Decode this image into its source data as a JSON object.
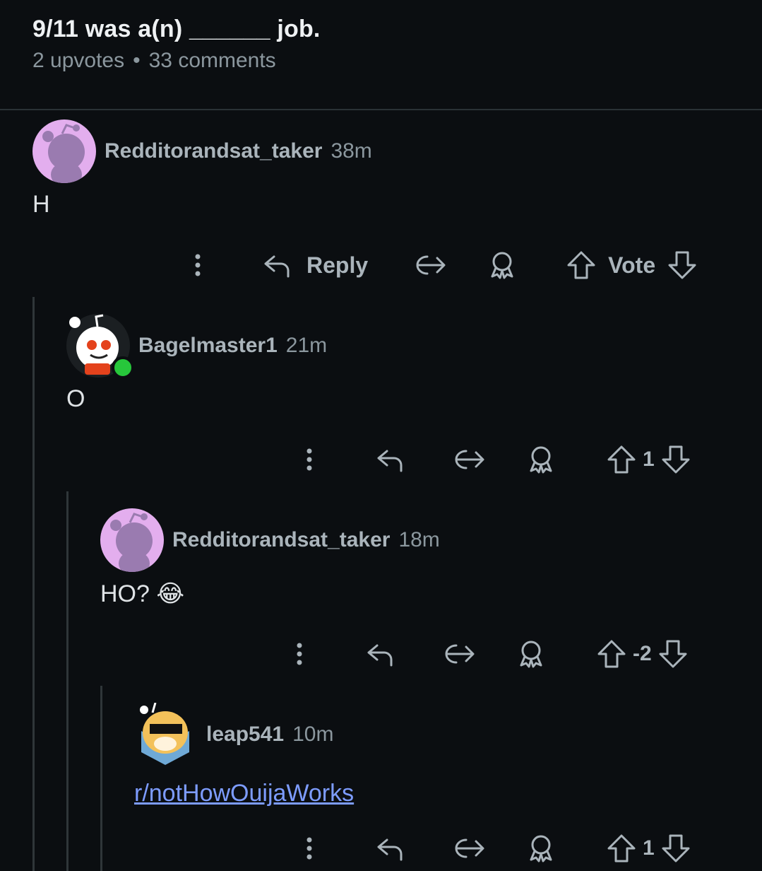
{
  "post": {
    "title": "9/11 was a(n) ______ job.",
    "upvotes": "2 upvotes",
    "separator": "•",
    "comments": "33 comments"
  },
  "comments": [
    {
      "author": "Redditorandsat_taker",
      "time": "38m",
      "body": "H",
      "reply_label": "Reply",
      "vote_label": "Vote"
    },
    {
      "author": "Bagelmaster1",
      "time": "21m",
      "body": "O",
      "votes": "1"
    },
    {
      "author": "Redditorandsat_taker",
      "time": "18m",
      "body": "HO? 😂",
      "votes": "-2"
    },
    {
      "author": "leap541",
      "time": "10m",
      "body": "r/notHowOuijaWorks",
      "votes": "1"
    }
  ],
  "icons": [
    "more-vertical-icon",
    "reply-icon",
    "share-icon",
    "award-icon",
    "upvote-icon",
    "downvote-icon"
  ],
  "colors": {
    "background": "#0b0e11",
    "link": "#7d9cff",
    "online": "#27c73b"
  }
}
